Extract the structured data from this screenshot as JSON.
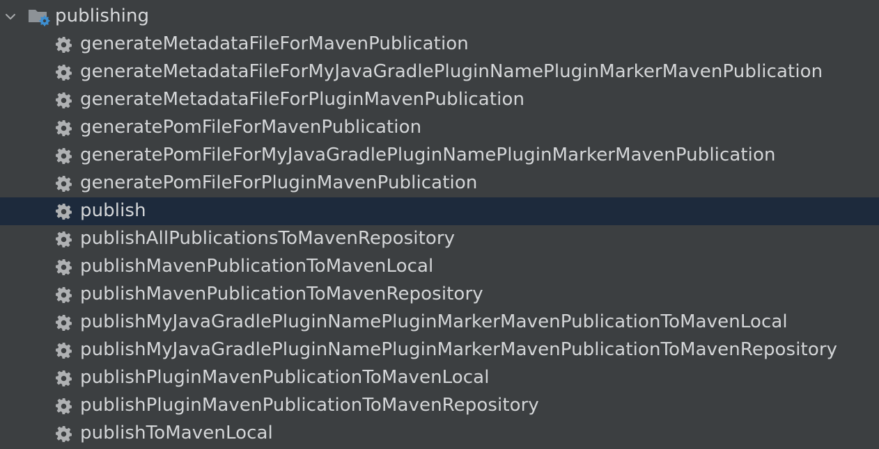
{
  "group": {
    "label": "publishing",
    "expanded": true,
    "icon": "folder-gear-icon"
  },
  "tasks": [
    {
      "label": "generateMetadataFileForMavenPublication",
      "selected": false
    },
    {
      "label": "generateMetadataFileForMyJavaGradlePluginNamePluginMarkerMavenPublication",
      "selected": false
    },
    {
      "label": "generateMetadataFileForPluginMavenPublication",
      "selected": false
    },
    {
      "label": "generatePomFileForMavenPublication",
      "selected": false
    },
    {
      "label": "generatePomFileForMyJavaGradlePluginNamePluginMarkerMavenPublication",
      "selected": false
    },
    {
      "label": "generatePomFileForPluginMavenPublication",
      "selected": false
    },
    {
      "label": "publish",
      "selected": true
    },
    {
      "label": "publishAllPublicationsToMavenRepository",
      "selected": false
    },
    {
      "label": "publishMavenPublicationToMavenLocal",
      "selected": false
    },
    {
      "label": "publishMavenPublicationToMavenRepository",
      "selected": false
    },
    {
      "label": "publishMyJavaGradlePluginNamePluginMarkerMavenPublicationToMavenLocal",
      "selected": false
    },
    {
      "label": "publishMyJavaGradlePluginNamePluginMarkerMavenPublicationToMavenRepository",
      "selected": false
    },
    {
      "label": "publishPluginMavenPublicationToMavenLocal",
      "selected": false
    },
    {
      "label": "publishPluginMavenPublicationToMavenRepository",
      "selected": false
    },
    {
      "label": "publishToMavenLocal",
      "selected": false
    }
  ],
  "colors": {
    "background": "#3c3f41",
    "selection": "#1d2a3c",
    "text": "#d4d6d8",
    "icon": "#afb1b3",
    "folder_badge": "#3d8fd1"
  }
}
